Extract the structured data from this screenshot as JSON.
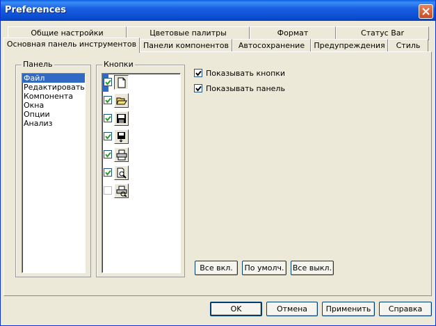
{
  "window": {
    "title": "Preferences"
  },
  "tabs_back": [
    {
      "label": "Общие настройки"
    },
    {
      "label": "Цветовые палитры"
    },
    {
      "label": "Формат"
    },
    {
      "label": "Статус Bar"
    }
  ],
  "tabs_front": [
    {
      "label": "Основная панель инструментов",
      "active": true
    },
    {
      "label": "Панели компонентов"
    },
    {
      "label": "Автосохранение"
    },
    {
      "label": "Предупреждения"
    },
    {
      "label": "Стиль"
    }
  ],
  "panel_group": {
    "label": "Панель",
    "items": [
      {
        "label": "Файл",
        "selected": true
      },
      {
        "label": "Редактировать"
      },
      {
        "label": "Компонента"
      },
      {
        "label": "Окна"
      },
      {
        "label": "Опции"
      },
      {
        "label": "Анализ"
      }
    ]
  },
  "buttons_group": {
    "label": "Кнопки",
    "items": [
      {
        "icon": "new-document-icon",
        "checked": true,
        "selected": true
      },
      {
        "icon": "open-folder-icon",
        "checked": true
      },
      {
        "icon": "save-icon",
        "checked": true
      },
      {
        "icon": "save-as-icon",
        "checked": true
      },
      {
        "icon": "print-icon",
        "checked": true
      },
      {
        "icon": "print-preview-icon",
        "checked": true
      },
      {
        "icon": "print-setup-icon",
        "checked": false
      }
    ]
  },
  "options": {
    "show_buttons": {
      "label": "Показывать кнопки",
      "checked": true
    },
    "show_panel": {
      "label": "Показывать панель",
      "checked": true
    }
  },
  "actions": {
    "all_on": "Все вкл.",
    "default": "По умолч.",
    "all_off": "Все выкл."
  },
  "dialog_buttons": {
    "ok": "OK",
    "cancel": "Отмена",
    "apply": "Применить",
    "help": "Справка"
  },
  "colors": {
    "titlebar": "#0A4CD0",
    "selection": "#316AC5",
    "face": "#ECE9D8"
  }
}
